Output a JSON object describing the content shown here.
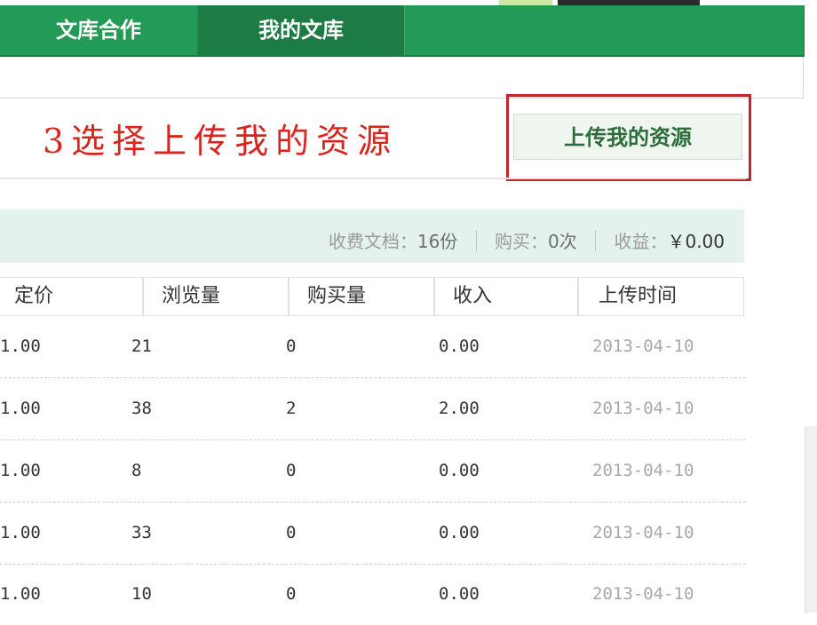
{
  "nav": {
    "tabs": [
      {
        "label": "文库合作"
      },
      {
        "label": "我的文库"
      }
    ]
  },
  "instruction": {
    "text": "3选择上传我的资源"
  },
  "upload_button": {
    "label": "上传我的资源"
  },
  "summary": {
    "docs_label": "收费文档：",
    "docs_value": "16份",
    "buys_label": "购买：",
    "buys_value": "0次",
    "income_label": "收益：",
    "income_value": "￥0.00"
  },
  "table": {
    "headers": [
      "定价",
      "浏览量",
      "购买量",
      "收入",
      "上传时间"
    ],
    "rows": [
      [
        "1.00",
        "21",
        "0",
        "0.00",
        "2013-04-10"
      ],
      [
        "1.00",
        "38",
        "2",
        "2.00",
        "2013-04-10"
      ],
      [
        "1.00",
        "8",
        "0",
        "0.00",
        "2013-04-10"
      ],
      [
        "1.00",
        "33",
        "0",
        "0.00",
        "2013-04-10"
      ],
      [
        "1.00",
        "10",
        "0",
        "0.00",
        "2013-04-10"
      ]
    ]
  },
  "colors": {
    "nav_bg": "#239a55",
    "nav_active": "#1c7c44",
    "instruction": "#d8261f",
    "highlight_border": "#c0262c",
    "summary_bg": "#e4f2ed"
  }
}
